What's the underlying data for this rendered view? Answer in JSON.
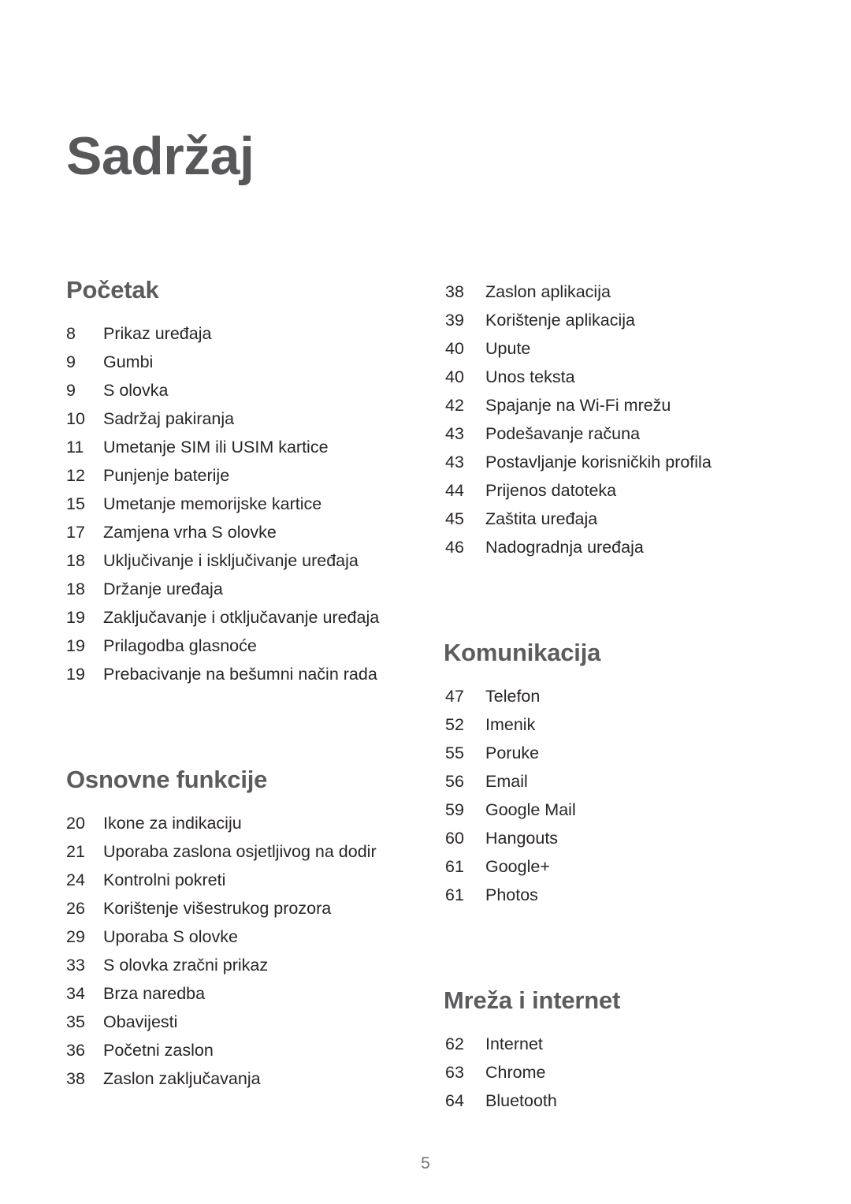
{
  "document": {
    "title": "Sadržaj",
    "page_number": "5",
    "title_color": "#58585b",
    "heading_color": "#5c5c5f",
    "body_color": "#2a2526",
    "folio_color": "#6e7679"
  },
  "columns": {
    "left": [
      {
        "heading": "Početak",
        "entries": [
          {
            "page": "8",
            "label": "Prikaz uređaja"
          },
          {
            "page": "9",
            "label": "Gumbi"
          },
          {
            "page": "9",
            "label": "S olovka"
          },
          {
            "page": "10",
            "label": "Sadržaj pakiranja"
          },
          {
            "page": "11",
            "label": "Umetanje SIM ili USIM kartice"
          },
          {
            "page": "12",
            "label": "Punjenje baterije"
          },
          {
            "page": "15",
            "label": "Umetanje memorijske kartice"
          },
          {
            "page": "17",
            "label": "Zamjena vrha S olovke"
          },
          {
            "page": "18",
            "label": "Uključivanje i isključivanje uređaja"
          },
          {
            "page": "18",
            "label": "Držanje uređaja"
          },
          {
            "page": "19",
            "label": "Zaključavanje i otključavanje uređaja"
          },
          {
            "page": "19",
            "label": "Prilagodba glasnoće"
          },
          {
            "page": "19",
            "label": "Prebacivanje na bešumni način rada"
          }
        ]
      },
      {
        "heading": "Osnovne funkcije",
        "entries": [
          {
            "page": "20",
            "label": "Ikone za indikaciju"
          },
          {
            "page": "21",
            "label": "Uporaba zaslona osjetljivog na dodir"
          },
          {
            "page": "24",
            "label": "Kontrolni pokreti"
          },
          {
            "page": "26",
            "label": "Korištenje višestrukog prozora"
          },
          {
            "page": "29",
            "label": "Uporaba S olovke"
          },
          {
            "page": "33",
            "label": "S olovka zračni prikaz"
          },
          {
            "page": "34",
            "label": "Brza naredba"
          },
          {
            "page": "35",
            "label": "Obavijesti"
          },
          {
            "page": "36",
            "label": "Početni zaslon"
          },
          {
            "page": "38",
            "label": "Zaslon zaključavanja"
          }
        ]
      }
    ],
    "right": [
      {
        "heading": "",
        "entries": [
          {
            "page": "38",
            "label": "Zaslon aplikacija"
          },
          {
            "page": "39",
            "label": "Korištenje aplikacija"
          },
          {
            "page": "40",
            "label": "Upute"
          },
          {
            "page": "40",
            "label": "Unos teksta"
          },
          {
            "page": "42",
            "label": "Spajanje na Wi-Fi mrežu"
          },
          {
            "page": "43",
            "label": "Podešavanje računa"
          },
          {
            "page": "43",
            "label": "Postavljanje korisničkih profila"
          },
          {
            "page": "44",
            "label": "Prijenos datoteka"
          },
          {
            "page": "45",
            "label": "Zaštita uređaja"
          },
          {
            "page": "46",
            "label": "Nadogradnja uređaja"
          }
        ]
      },
      {
        "heading": "Komunikacija",
        "entries": [
          {
            "page": "47",
            "label": "Telefon"
          },
          {
            "page": "52",
            "label": "Imenik"
          },
          {
            "page": "55",
            "label": "Poruke"
          },
          {
            "page": "56",
            "label": "Email"
          },
          {
            "page": "59",
            "label": "Google Mail"
          },
          {
            "page": "60",
            "label": "Hangouts"
          },
          {
            "page": "61",
            "label": "Google+"
          },
          {
            "page": "61",
            "label": "Photos"
          }
        ]
      },
      {
        "heading": "Mreža i internet",
        "entries": [
          {
            "page": "62",
            "label": "Internet"
          },
          {
            "page": "63",
            "label": "Chrome"
          },
          {
            "page": "64",
            "label": "Bluetooth"
          }
        ]
      }
    ]
  }
}
